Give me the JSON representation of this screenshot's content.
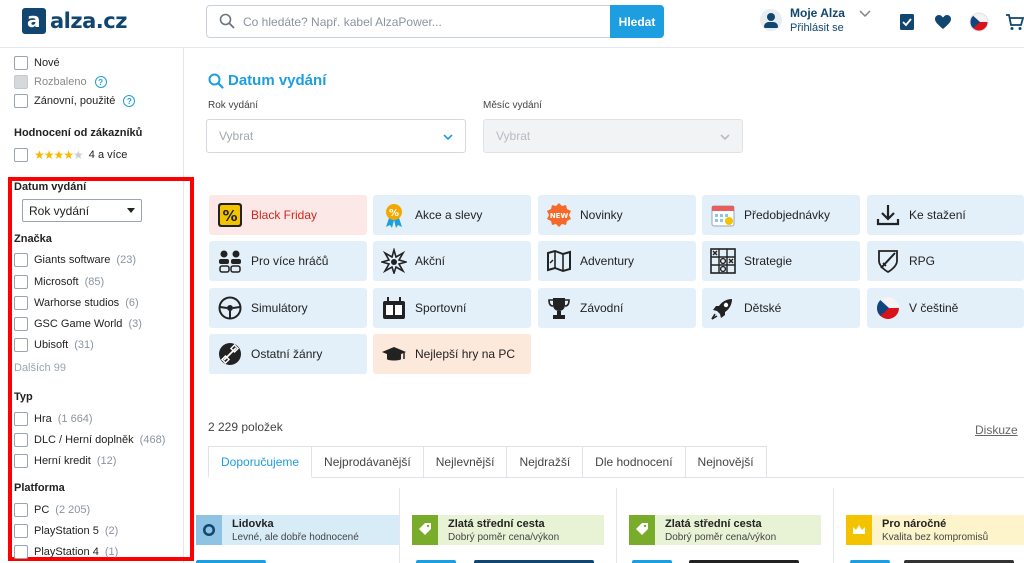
{
  "header": {
    "logo_text": "alza.cz",
    "search_placeholder": "Co hledáte? Např. kabel AlzaPower...",
    "search_button": "Hledat",
    "user_name": "Moje Alza",
    "user_sub": "Přihlásit se"
  },
  "sidebar": {
    "state_items": [
      {
        "label": "Nové"
      },
      {
        "label": "Rozbaleno"
      },
      {
        "label": "Zánovní, použité"
      }
    ],
    "rating_title": "Hodnocení od zákazníků",
    "rating_label": "4 a více",
    "rating_stars": 4,
    "release_title": "Datum vydání",
    "release_select": "Rok vydání",
    "brand_title": "Značka",
    "brands": [
      {
        "label": "Giants software",
        "count": "(23)"
      },
      {
        "label": "Microsoft",
        "count": "(85)"
      },
      {
        "label": "Warhorse studios",
        "count": "(6)"
      },
      {
        "label": "GSC Game World",
        "count": "(3)"
      },
      {
        "label": "Ubisoft",
        "count": "(31)"
      }
    ],
    "brand_more": "Dalších 99",
    "type_title": "Typ",
    "types": [
      {
        "label": "Hra",
        "count": "(1 664)"
      },
      {
        "label": "DLC / Herní doplněk",
        "count": "(468)"
      },
      {
        "label": "Herní kredit",
        "count": "(12)"
      }
    ],
    "platform_title": "Platforma",
    "platforms": [
      {
        "label": "PC",
        "count": "(2 205)"
      },
      {
        "label": "PlayStation 5",
        "count": "(2)"
      },
      {
        "label": "PlayStation 4",
        "count": "(1)"
      }
    ]
  },
  "main": {
    "title": "Datum vydání",
    "year_label": "Rok vydání",
    "year_value": "Vybrat",
    "month_label": "Měsíc vydání",
    "month_value": "Vybrat",
    "tiles": [
      {
        "label": "Black Friday",
        "icon": "percent-tag-icon"
      },
      {
        "label": "Akce a slevy",
        "icon": "medal-icon"
      },
      {
        "label": "Novinky",
        "icon": "new-badge-icon"
      },
      {
        "label": "Předobjednávky",
        "icon": "calendar-icon"
      },
      {
        "label": "Ke stažení",
        "icon": "download-icon"
      },
      {
        "label": "Pro více hráčů",
        "icon": "multiplayer-icon"
      },
      {
        "label": "Akční",
        "icon": "explosion-icon"
      },
      {
        "label": "Adventury",
        "icon": "map-icon"
      },
      {
        "label": "Strategie",
        "icon": "tic-tac-toe-icon"
      },
      {
        "label": "RPG",
        "icon": "sword-shield-icon"
      },
      {
        "label": "Simulátory",
        "icon": "steering-wheel-icon"
      },
      {
        "label": "Sportovní",
        "icon": "scoreboard-icon"
      },
      {
        "label": "Závodní",
        "icon": "trophy-icon"
      },
      {
        "label": "Dětské",
        "icon": "rocket-icon"
      },
      {
        "label": "V češtině",
        "icon": "czech-flag-icon"
      },
      {
        "label": "Ostatní žánry",
        "icon": "satellite-icon"
      },
      {
        "label": "Nejlepší hry na PC",
        "icon": "graduation-cap-icon"
      }
    ],
    "items_count": "2 229 položek",
    "diskuze": "Diskuze",
    "tabs": [
      "Doporučujeme",
      "Nejprodávanější",
      "Nejlevnější",
      "Nejdražší",
      "Dle hodnocení",
      "Nejnovější"
    ],
    "active_tab": 0,
    "badges": [
      {
        "title": "Lidovka",
        "sub": "Levné, ale dobře hodnocené",
        "color": "blue"
      },
      {
        "title": "Zlatá střední cesta",
        "sub": "Dobrý poměr cena/výkon",
        "color": "green"
      },
      {
        "title": "Zlatá střední cesta",
        "sub": "Dobrý poměr cena/výkon",
        "color": "green"
      },
      {
        "title": "Pro náročné",
        "sub": "Kvalita bez kompromisů",
        "color": "yellow"
      }
    ]
  },
  "colors": {
    "accent": "#1d9ee0",
    "brand": "#10466f",
    "highlight": "#ff0000",
    "black_friday": "#d0271d"
  }
}
